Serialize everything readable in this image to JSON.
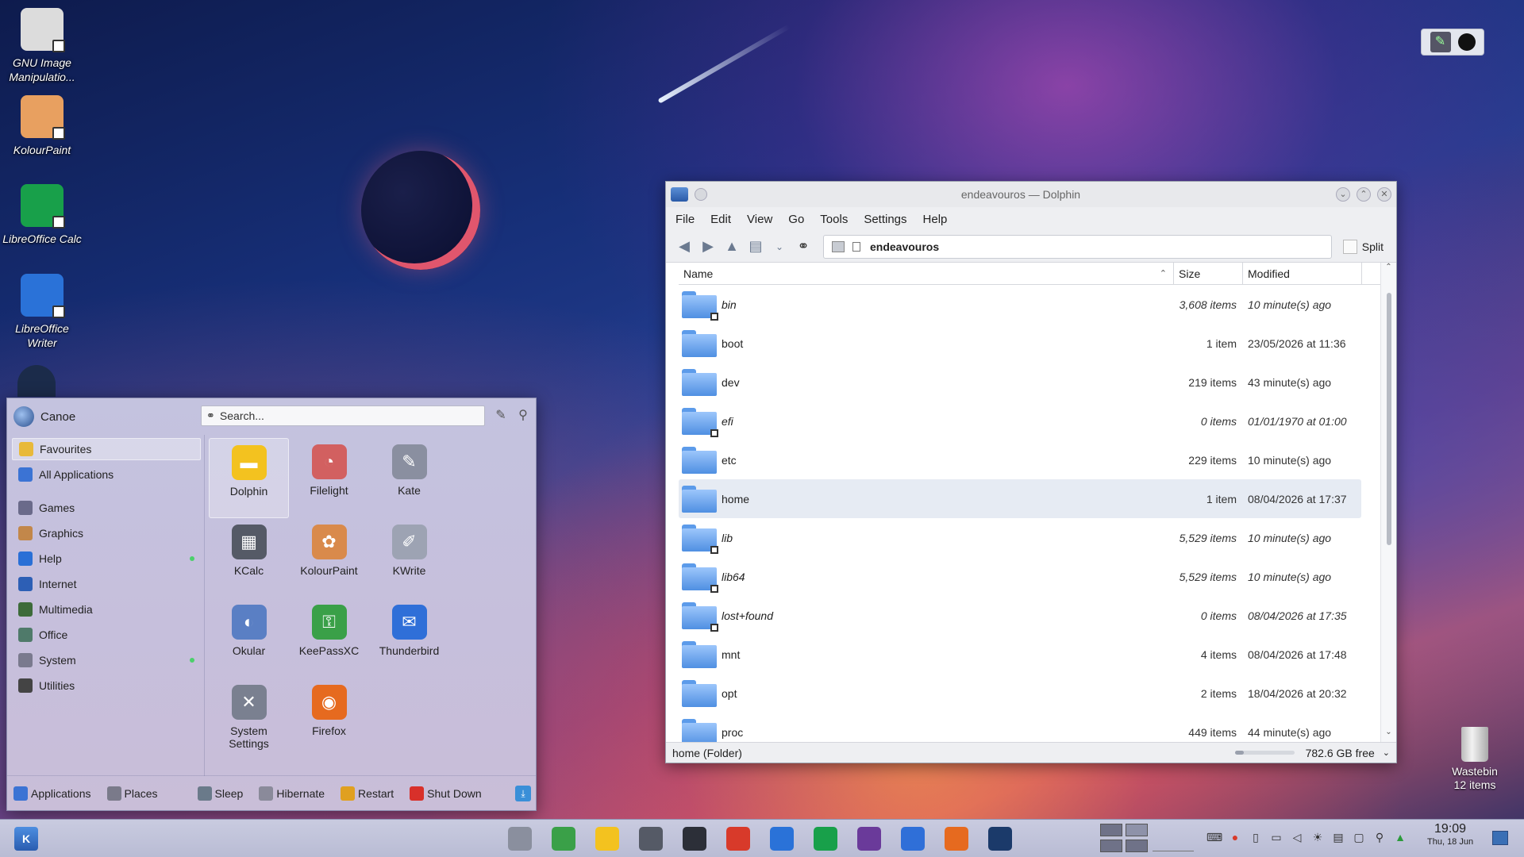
{
  "desktop": {
    "icons": [
      {
        "label": "GNU Image Manipulatio...",
        "icon": "gimp-icon",
        "color": "#dcdcdc"
      },
      {
        "label": "KolourPaint",
        "icon": "kolourpaint-icon",
        "color": "#e8a060"
      },
      {
        "label": "LibreOffice Calc",
        "icon": "calc-icon",
        "color": "#18a04a"
      },
      {
        "label": "LibreOffice Writer",
        "icon": "writer-icon",
        "color": "#2a72d8"
      }
    ],
    "wastebin": {
      "label": "Wastebin",
      "count": "12 items"
    }
  },
  "dolphin": {
    "title": "endeavouros — Dolphin",
    "menu": [
      "File",
      "Edit",
      "View",
      "Go",
      "Tools",
      "Settings",
      "Help"
    ],
    "location": "endeavouros",
    "split_label": "Split",
    "columns": {
      "name": "Name",
      "size": "Size",
      "modified": "Modified"
    },
    "rows": [
      {
        "name": "bin",
        "size": "3,608 items",
        "modified": "10 minute(s) ago",
        "link": true,
        "selected": false
      },
      {
        "name": "boot",
        "size": "1 item",
        "modified": "23/05/2026 at 11:36",
        "link": false,
        "selected": false
      },
      {
        "name": "dev",
        "size": "219 items",
        "modified": "43 minute(s) ago",
        "link": false,
        "selected": false
      },
      {
        "name": "efi",
        "size": "0 items",
        "modified": "01/01/1970 at 01:00",
        "link": true,
        "selected": false
      },
      {
        "name": "etc",
        "size": "229 items",
        "modified": "10 minute(s) ago",
        "link": false,
        "selected": false
      },
      {
        "name": "home",
        "size": "1 item",
        "modified": "08/04/2026 at 17:37",
        "link": false,
        "selected": true
      },
      {
        "name": "lib",
        "size": "5,529 items",
        "modified": "10 minute(s) ago",
        "link": true,
        "selected": false
      },
      {
        "name": "lib64",
        "size": "5,529 items",
        "modified": "10 minute(s) ago",
        "link": true,
        "selected": false
      },
      {
        "name": "lost+found",
        "size": "0 items",
        "modified": "08/04/2026 at 17:35",
        "link": true,
        "selected": false
      },
      {
        "name": "mnt",
        "size": "4 items",
        "modified": "08/04/2026 at 17:48",
        "link": false,
        "selected": false
      },
      {
        "name": "opt",
        "size": "2 items",
        "modified": "18/04/2026 at 20:32",
        "link": false,
        "selected": false
      },
      {
        "name": "proc",
        "size": "449 items",
        "modified": "44 minute(s) ago",
        "link": false,
        "selected": false
      }
    ],
    "status": "home (Folder)",
    "free_space": "782.6 GB free",
    "free_space_fraction": 0.15
  },
  "menu": {
    "user": "Canoe",
    "search_placeholder": "Search...",
    "categories": [
      {
        "label": "Favourites",
        "icon": "star-icon",
        "color": "#e8b93a",
        "active": true,
        "new": false,
        "gap": false
      },
      {
        "label": "All Applications",
        "icon": "grid-icon",
        "color": "#3b73d4",
        "active": false,
        "new": false,
        "gap": false
      },
      {
        "label": "Games",
        "icon": "games-icon",
        "color": "#6a6a8a",
        "active": false,
        "new": false,
        "gap": true
      },
      {
        "label": "Graphics",
        "icon": "graphics-icon",
        "color": "#c2874a",
        "active": false,
        "new": false,
        "gap": false
      },
      {
        "label": "Help",
        "icon": "help-icon",
        "color": "#2a6fd6",
        "active": false,
        "new": true,
        "gap": false
      },
      {
        "label": "Internet",
        "icon": "globe-icon",
        "color": "#2d5fb5",
        "active": false,
        "new": false,
        "gap": false
      },
      {
        "label": "Multimedia",
        "icon": "multimedia-icon",
        "color": "#3d6b3a",
        "active": false,
        "new": false,
        "gap": false
      },
      {
        "label": "Office",
        "icon": "office-icon",
        "color": "#4f7a6a",
        "active": false,
        "new": false,
        "gap": false
      },
      {
        "label": "System",
        "icon": "gear-icon",
        "color": "#7a7a8e",
        "active": false,
        "new": true,
        "gap": false
      },
      {
        "label": "Utilities",
        "icon": "utilities-icon",
        "color": "#444",
        "active": false,
        "new": false,
        "gap": false
      }
    ],
    "apps": [
      {
        "label": "Dolphin",
        "icon": "folder-icon",
        "color": "#f3c21f",
        "glyph": "▬",
        "active": true
      },
      {
        "label": "Filelight",
        "icon": "filelight-icon",
        "color": "#d26060",
        "glyph": "◔",
        "active": false
      },
      {
        "label": "Kate",
        "icon": "kate-icon",
        "color": "#8a8fa0",
        "glyph": "✎",
        "active": false
      },
      {
        "label": "KCalc",
        "icon": "calculator-icon",
        "color": "#555a66",
        "glyph": "▦",
        "active": false
      },
      {
        "label": "KolourPaint",
        "icon": "kolourpaint-icon",
        "color": "#d98a4b",
        "glyph": "✿",
        "active": false
      },
      {
        "label": "KWrite",
        "icon": "kwrite-icon",
        "color": "#9da3b3",
        "glyph": "✐",
        "active": false
      },
      {
        "label": "Okular",
        "icon": "okular-icon",
        "color": "#5a7fc4",
        "glyph": "◐",
        "active": false
      },
      {
        "label": "KeePassXC",
        "icon": "keepass-icon",
        "color": "#3aa048",
        "glyph": "⚿",
        "active": false
      },
      {
        "label": "Thunderbird",
        "icon": "thunderbird-icon",
        "color": "#2f6fd8",
        "glyph": "✉",
        "active": false
      },
      {
        "label": "System Settings",
        "icon": "settings-icon",
        "color": "#7a8090",
        "glyph": "✕",
        "active": false
      },
      {
        "label": "Firefox",
        "icon": "firefox-icon",
        "color": "#e66a1f",
        "glyph": "◉",
        "active": false
      }
    ],
    "bottom": [
      {
        "label": "Applications",
        "icon": "grid-icon",
        "color": "#3b73d4"
      },
      {
        "label": "Places",
        "icon": "compass-icon",
        "color": "#7a7a8a"
      },
      {
        "label": "Sleep",
        "icon": "sleep-icon",
        "color": "#6a7a8a"
      },
      {
        "label": "Hibernate",
        "icon": "hibernate-icon",
        "color": "#8a8a9a"
      },
      {
        "label": "Restart",
        "icon": "restart-icon",
        "color": "#e0a020"
      },
      {
        "label": "Shut Down",
        "icon": "shutdown-icon",
        "color": "#d8302a"
      }
    ]
  },
  "taskbar": {
    "launcher": "K",
    "items": [
      {
        "icon": "settings-icon",
        "color": "#8a8f9e"
      },
      {
        "icon": "keepass-icon",
        "color": "#3aa048"
      },
      {
        "icon": "folder-icon",
        "color": "#f3c21f"
      },
      {
        "icon": "monitor-icon",
        "color": "#555a66"
      },
      {
        "icon": "terminal-icon",
        "color": "#2c2f38"
      },
      {
        "icon": "tomato-icon",
        "color": "#d83a2a"
      },
      {
        "icon": "writer-icon",
        "color": "#2a72d8"
      },
      {
        "icon": "calc-icon",
        "color": "#18a04a"
      },
      {
        "icon": "tor-icon",
        "color": "#6a3a9a"
      },
      {
        "icon": "thunderbird-icon",
        "color": "#2f6fd8"
      },
      {
        "icon": "firefox-icon",
        "color": "#e66a1f"
      },
      {
        "icon": "steam-icon",
        "color": "#1b3a6a"
      }
    ],
    "time": "19:09",
    "date": "Thu, 18 Jun"
  }
}
